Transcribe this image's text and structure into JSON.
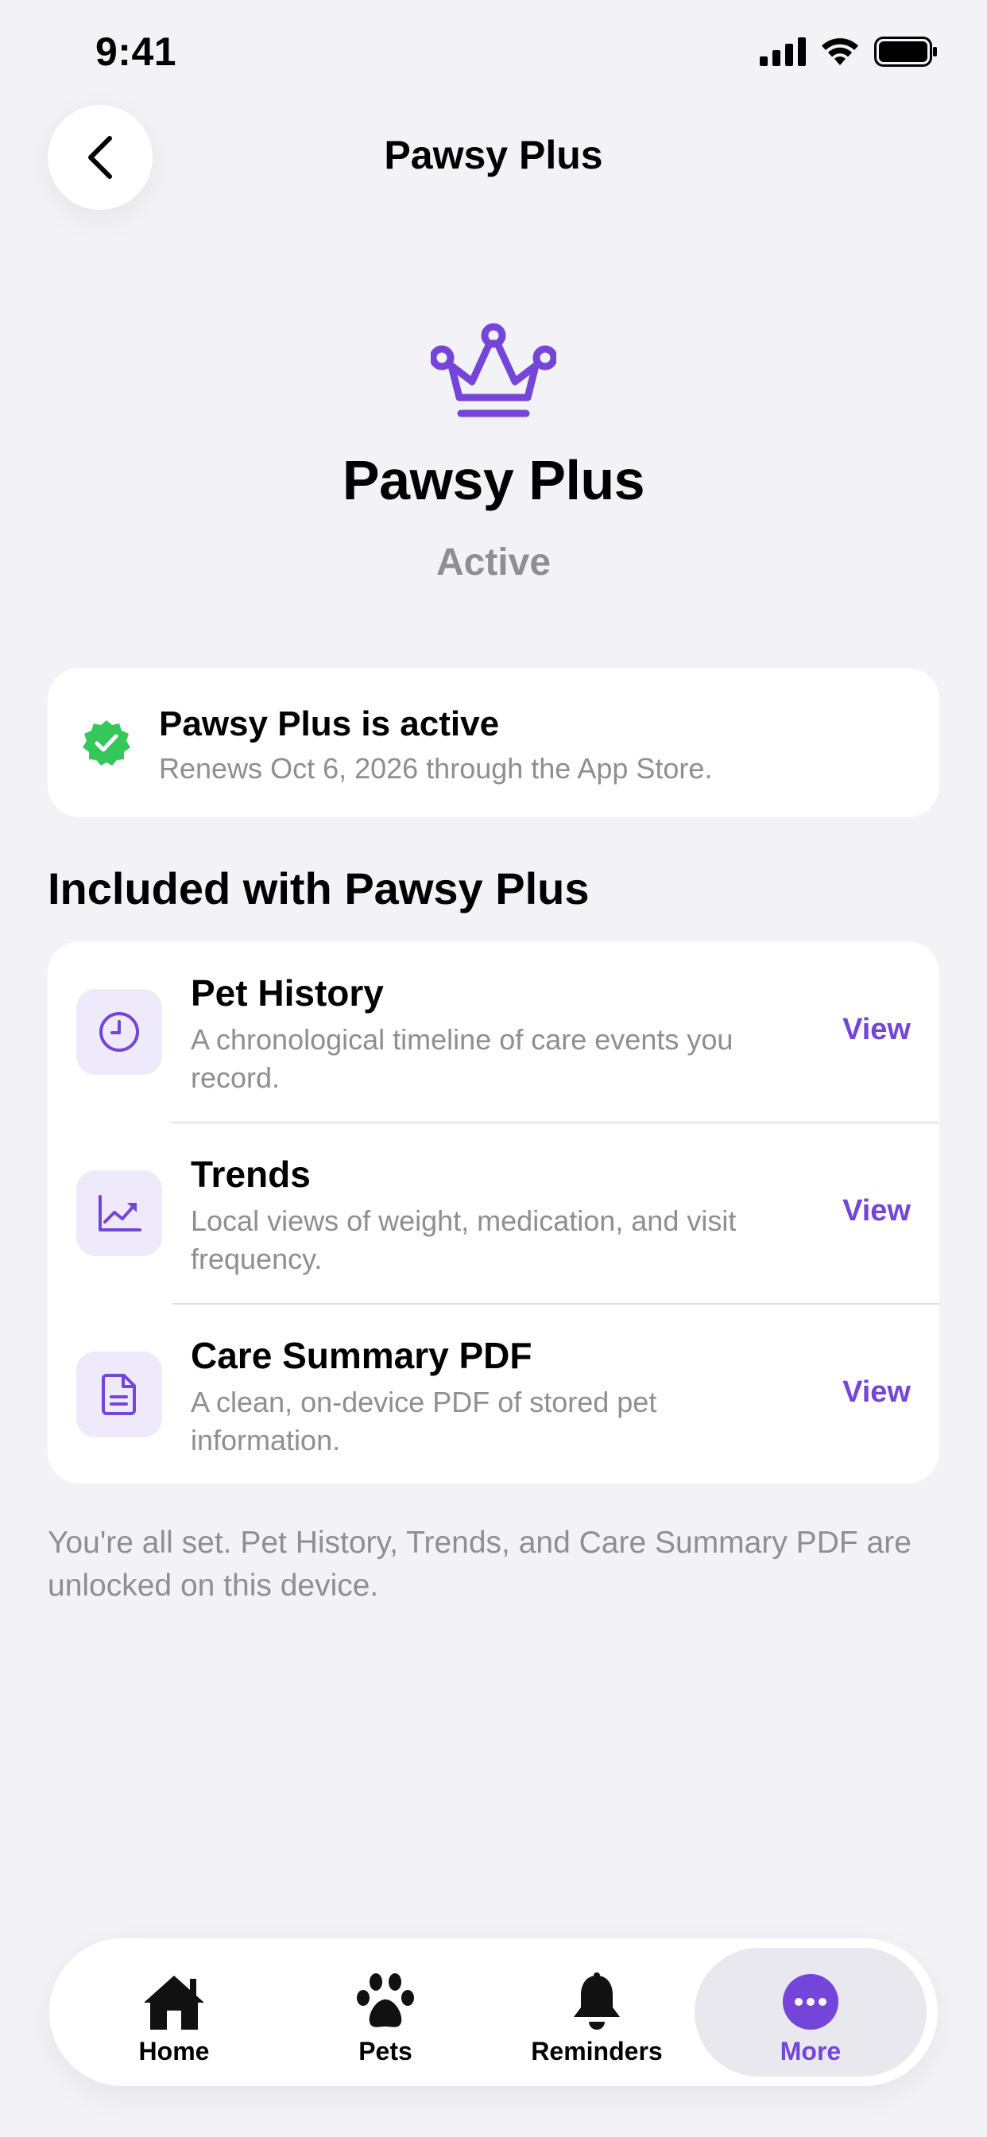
{
  "status_bar": {
    "time": "9:41"
  },
  "header": {
    "title": "Pawsy Plus"
  },
  "hero": {
    "title": "Pawsy Plus",
    "subtitle": "Active"
  },
  "status_card": {
    "title": "Pawsy Plus is active",
    "subtitle": "Renews Oct 6, 2026 through the App Store."
  },
  "features": {
    "section_title": "Included with Pawsy Plus",
    "items": [
      {
        "title": "Pet History",
        "description": "A chronological timeline of care events you record.",
        "action": "View",
        "icon": "clock-icon"
      },
      {
        "title": "Trends",
        "description": "Local views of weight, medication, and visit frequency.",
        "action": "View",
        "icon": "trend-chart-icon"
      },
      {
        "title": "Care Summary PDF",
        "description": "A clean, on-device PDF of stored pet information.",
        "action": "View",
        "icon": "document-icon"
      }
    ]
  },
  "footer_note": "You're all set. Pet History, Trends, and Care Summary PDF are unlocked on this device.",
  "tab_bar": {
    "items": [
      {
        "label": "Home",
        "icon": "house-icon",
        "active": false
      },
      {
        "label": "Pets",
        "icon": "paw-icon",
        "active": false
      },
      {
        "label": "Reminders",
        "icon": "bell-icon",
        "active": false
      },
      {
        "label": "More",
        "icon": "more-icon",
        "active": true
      }
    ]
  },
  "colors": {
    "accent": "#7445D8",
    "success": "#34C759",
    "background": "#F2F2F7",
    "secondary_text": "#8E8E93"
  }
}
